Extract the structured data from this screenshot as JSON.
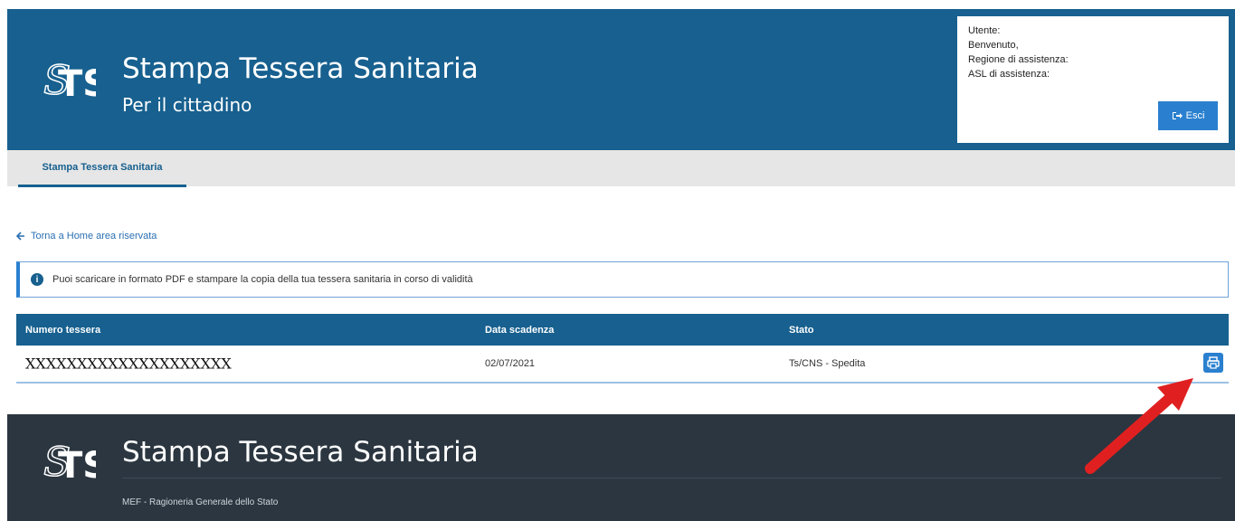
{
  "header": {
    "title": "Stampa Tessera Sanitaria",
    "subtitle": "Per il cittadino",
    "logo_icon": "sts-logo-icon"
  },
  "user_panel": {
    "utente": "Utente:",
    "benvenuto": "Benvenuto,",
    "regione": "Regione di assistenza:",
    "asl": "ASL di assistenza:",
    "exit_label": "Esci",
    "exit_icon": "sign-out-icon"
  },
  "tabs": [
    {
      "label": "Stampa Tessera Sanitaria",
      "active": true
    }
  ],
  "back_link": {
    "label": "Torna a Home area riservata",
    "icon": "arrow-left-icon"
  },
  "info": {
    "icon": "info-circle-icon",
    "text": "Puoi scaricare in formato PDF e stampare la copia della tua tessera sanitaria in corso di validità"
  },
  "table": {
    "columns": [
      "Numero tessera",
      "Data scadenza",
      "Stato"
    ],
    "rows": [
      {
        "numero": "XXXXXXXXXXXXXXXXXXXX",
        "scadenza": "02/07/2021",
        "stato": "Ts/CNS - Spedita",
        "action_icon": "print-icon"
      }
    ]
  },
  "footer": {
    "title": "Stampa Tessera Sanitaria",
    "org": "MEF - Ragioneria Generale dello Stato"
  },
  "colors": {
    "primary": "#17608f",
    "accent": "#2a80cf",
    "footer_bg": "#2b3640",
    "arrow": "#e02020"
  }
}
